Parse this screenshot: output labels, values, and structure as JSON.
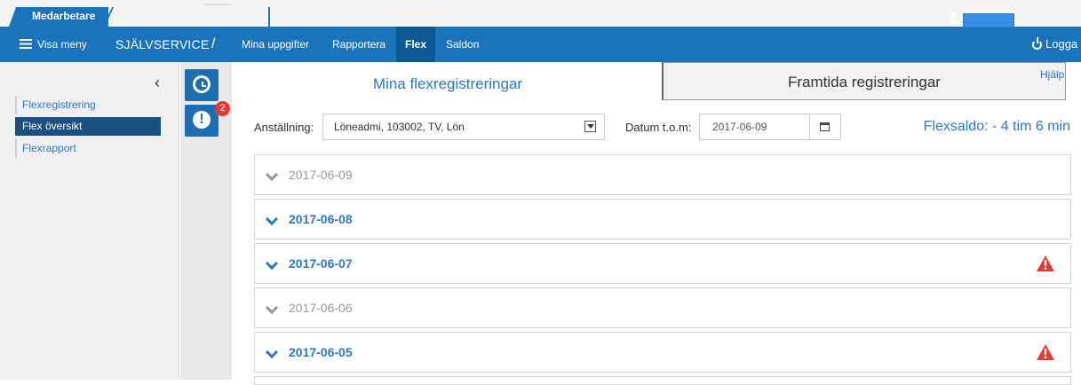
{
  "top_tab": {
    "label": "Medarbetare"
  },
  "nav": {
    "menu_label": "Visa meny",
    "brand": "SJÄLVSERVICE",
    "separator": "/",
    "items": [
      {
        "label": "Mina uppgifter"
      },
      {
        "label": "Rapportera"
      },
      {
        "label": "Flex"
      },
      {
        "label": "Saldon"
      }
    ],
    "logout_label": "Logga"
  },
  "sidebar": {
    "collapse_icon": "chevron-left-icon",
    "items": [
      {
        "label": "Flexregistrering"
      },
      {
        "label": "Flex översikt"
      },
      {
        "label": "Flexrapport"
      }
    ]
  },
  "icon_column": {
    "alert_badge": "2"
  },
  "tabs": {
    "mine": "Mina flexregistreringar",
    "future": "Framtida registreringar",
    "help": "Hjälp"
  },
  "filters": {
    "employment_label": "Anställning:",
    "employment_value": "Löneadmi, 103002, TV, Lön",
    "date_label": "Datum t.o.m:",
    "date_value": "2017-06-09"
  },
  "flex_balance": "Flexsaldo: - 4 tim 6 min",
  "days": [
    {
      "date": "2017-06-09"
    },
    {
      "date": "2017-06-08"
    },
    {
      "date": "2017-06-07"
    },
    {
      "date": "2017-06-06"
    },
    {
      "date": "2017-06-05"
    }
  ],
  "colors": {
    "accent": "#1b74bb",
    "link": "#2d78c5",
    "selected_sidebar": "#1a4f82",
    "warning": "#e53935"
  }
}
